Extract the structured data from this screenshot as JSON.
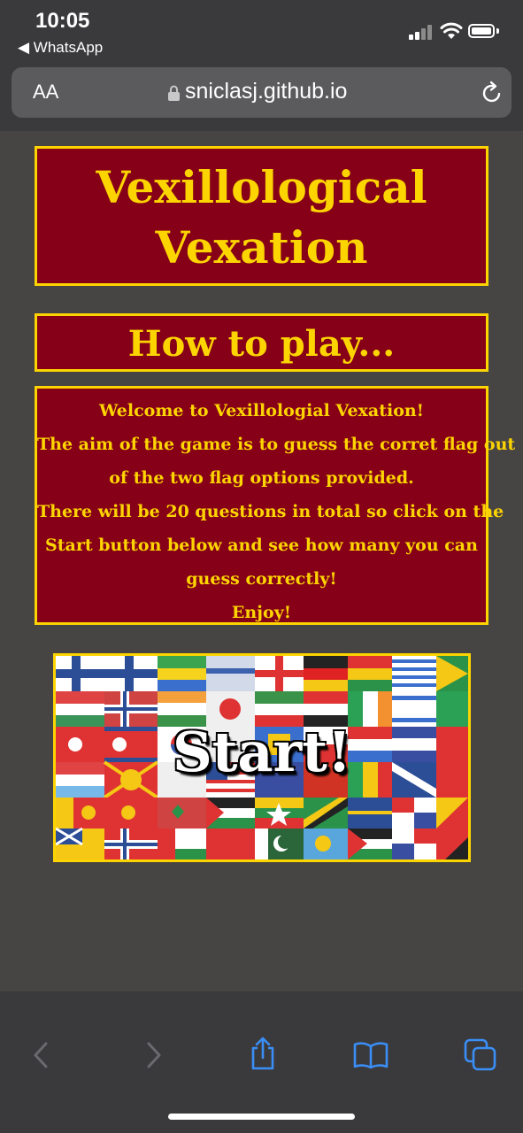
{
  "status_bar": {
    "time": "10:05",
    "back_app": "◀ WhatsApp"
  },
  "browser": {
    "text_size_button": "AA",
    "url": "sniclasj.github.io"
  },
  "game": {
    "title_line1": "Vexillological",
    "title_line2": "Vexation",
    "how_to_heading": "How to play...",
    "instructions": [
      "Welcome to Vexillologial Vexation!",
      "The aim of the game is to guess the corret flag out",
      "of the two flag options provided.",
      "There will be 20 questions in total so click on the",
      "Start button below and see how many you can",
      "guess correctly!",
      "Enjoy!"
    ],
    "start_label": "Start!"
  },
  "colors": {
    "page_bg": "#474444",
    "box_bg": "#860117",
    "accent_yellow": "#fcd400",
    "chrome_bg": "#3a3a3c",
    "toolbar_icon": "#3a8ef6"
  },
  "toolbar_icons": [
    "back-chevron-icon",
    "forward-chevron-icon",
    "share-icon",
    "bookmarks-icon",
    "tabs-icon"
  ]
}
